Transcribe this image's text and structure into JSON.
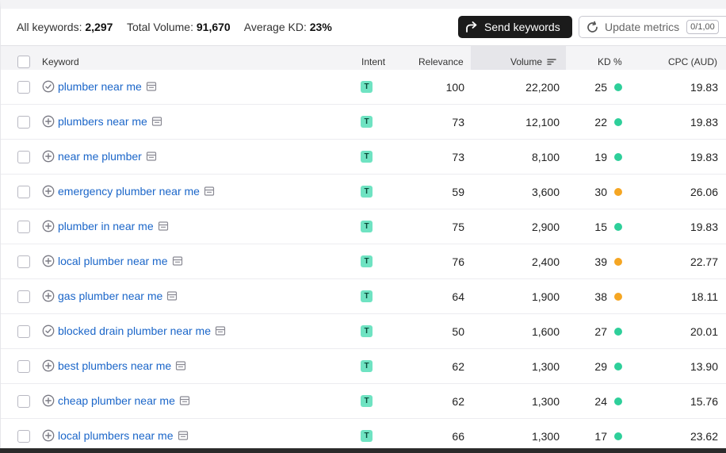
{
  "summary": {
    "all_keywords_label": "All keywords:",
    "all_keywords_value": "2,297",
    "total_volume_label": "Total Volume:",
    "total_volume_value": "91,670",
    "avg_kd_label": "Average KD:",
    "avg_kd_value": "23%"
  },
  "actions": {
    "send_label": "Send keywords",
    "update_label": "Update metrics",
    "quota": "0/1,00"
  },
  "columns": {
    "keyword": "Keyword",
    "intent": "Intent",
    "relevance": "Relevance",
    "volume": "Volume",
    "kd": "KD %",
    "cpc": "CPC (AUD)"
  },
  "colors": {
    "kd_easy": "#2ecf9a",
    "kd_medium": "#f5a623",
    "intent_badge": "#6fe3c2",
    "link": "#1b66c9"
  },
  "rows": [
    {
      "keyword": "plumber near me",
      "status": "added",
      "intent": "T",
      "relevance": "100",
      "volume": "22,200",
      "kd": "25",
      "kd_level": "easy",
      "cpc": "19.83"
    },
    {
      "keyword": "plumbers near me",
      "status": "add",
      "intent": "T",
      "relevance": "73",
      "volume": "12,100",
      "kd": "22",
      "kd_level": "easy",
      "cpc": "19.83"
    },
    {
      "keyword": "near me plumber",
      "status": "add",
      "intent": "T",
      "relevance": "73",
      "volume": "8,100",
      "kd": "19",
      "kd_level": "easy",
      "cpc": "19.83"
    },
    {
      "keyword": "emergency plumber near me",
      "status": "add",
      "intent": "T",
      "relevance": "59",
      "volume": "3,600",
      "kd": "30",
      "kd_level": "medium",
      "cpc": "26.06"
    },
    {
      "keyword": "plumber in near me",
      "status": "add",
      "intent": "T",
      "relevance": "75",
      "volume": "2,900",
      "kd": "15",
      "kd_level": "easy",
      "cpc": "19.83"
    },
    {
      "keyword": "local plumber near me",
      "status": "add",
      "intent": "T",
      "relevance": "76",
      "volume": "2,400",
      "kd": "39",
      "kd_level": "medium",
      "cpc": "22.77"
    },
    {
      "keyword": "gas plumber near me",
      "status": "add",
      "intent": "T",
      "relevance": "64",
      "volume": "1,900",
      "kd": "38",
      "kd_level": "medium",
      "cpc": "18.11"
    },
    {
      "keyword": "blocked drain plumber near me",
      "status": "added",
      "intent": "T",
      "relevance": "50",
      "volume": "1,600",
      "kd": "27",
      "kd_level": "easy",
      "cpc": "20.01"
    },
    {
      "keyword": "best plumbers near me",
      "status": "add",
      "intent": "T",
      "relevance": "62",
      "volume": "1,300",
      "kd": "29",
      "kd_level": "easy",
      "cpc": "13.90"
    },
    {
      "keyword": "cheap plumber near me",
      "status": "add",
      "intent": "T",
      "relevance": "62",
      "volume": "1,300",
      "kd": "24",
      "kd_level": "easy",
      "cpc": "15.76"
    },
    {
      "keyword": "local plumbers near me",
      "status": "add",
      "intent": "T",
      "relevance": "66",
      "volume": "1,300",
      "kd": "17",
      "kd_level": "easy",
      "cpc": "23.62"
    }
  ]
}
